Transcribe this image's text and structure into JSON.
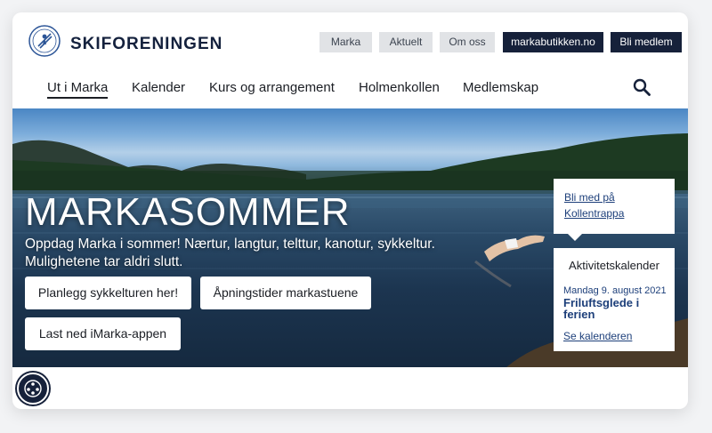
{
  "header": {
    "brand_name": "SKIFORENINGEN",
    "top_buttons": [
      "Marka",
      "Aktuelt",
      "Om oss",
      "markabutikken.no",
      "Bli medlem"
    ]
  },
  "nav": {
    "items": [
      "Ut i Marka",
      "Kalender",
      "Kurs og arrangement",
      "Holmenkollen",
      "Medlemskap"
    ],
    "active": "Ut i Marka",
    "search_icon": "search-icon"
  },
  "hero": {
    "title": "MARKASOMMER",
    "text": "Oppdag Marka i sommer! Nærtur, langtur, telttur, kanotur, sykkeltur. Mulighetene tar aldri slutt.",
    "buttons": [
      "Planlegg sykkelturen her!",
      "Åpningstider markastuene",
      "Last ned iMarka-appen"
    ]
  },
  "callout": {
    "link": "Bli med på Kollentrappa"
  },
  "calendar": {
    "title": "Aktivitetskalender",
    "date": "Mandag 9. august 2021",
    "event": "Friluftsglede i ferien",
    "more": "Se kalenderen"
  },
  "colors": {
    "brand_dark": "#16213a",
    "button_light": "#e1e3e6",
    "link_blue": "#1d3f7a"
  },
  "icons": {
    "logo": "skiforeningen-logo",
    "accessibility": "accessibility-icon"
  }
}
